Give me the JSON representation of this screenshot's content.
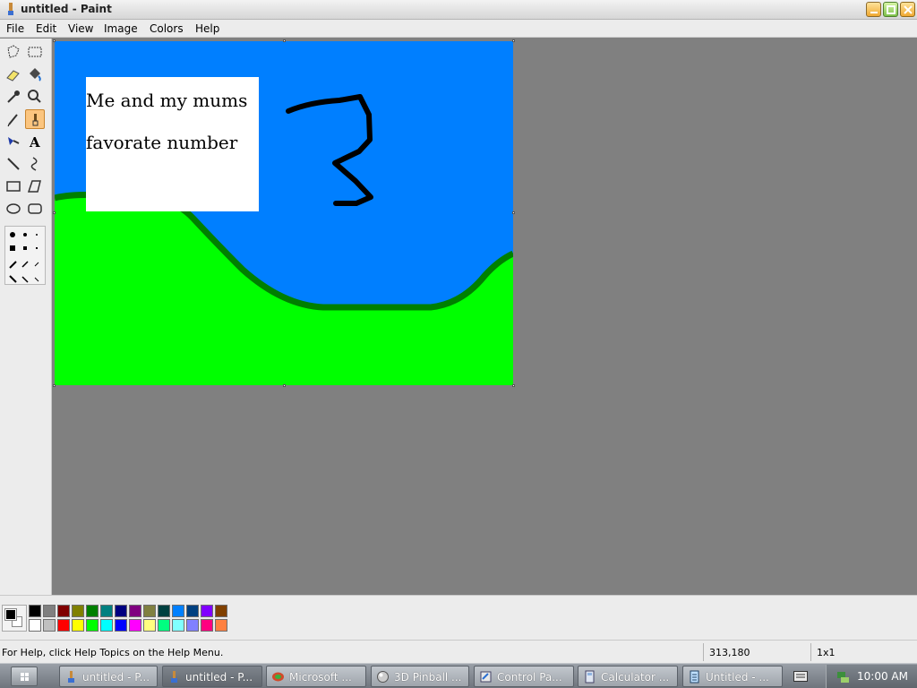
{
  "window": {
    "title": "untitled - Paint",
    "controls": [
      "minimize",
      "maximize",
      "close"
    ]
  },
  "menu": {
    "items": [
      "File",
      "Edit",
      "View",
      "Image",
      "Colors",
      "Help"
    ]
  },
  "toolbox": {
    "tools": [
      {
        "name": "free-form-select",
        "icon": "freeform-select-icon",
        "active": false
      },
      {
        "name": "select",
        "icon": "rect-select-icon",
        "active": false
      },
      {
        "name": "eraser",
        "icon": "eraser-icon",
        "active": false
      },
      {
        "name": "fill",
        "icon": "fill-bucket-icon",
        "active": false
      },
      {
        "name": "pick-color",
        "icon": "eyedropper-icon",
        "active": false
      },
      {
        "name": "magnifier",
        "icon": "magnifier-icon",
        "active": false
      },
      {
        "name": "pencil",
        "icon": "pencil-icon",
        "active": false
      },
      {
        "name": "brush",
        "icon": "brush-icon",
        "active": true
      },
      {
        "name": "airbrush",
        "icon": "airbrush-icon",
        "active": false
      },
      {
        "name": "text",
        "icon": "text-icon",
        "active": false
      },
      {
        "name": "line",
        "icon": "line-icon",
        "active": false
      },
      {
        "name": "curve",
        "icon": "curve-icon",
        "active": false
      },
      {
        "name": "rectangle",
        "icon": "rectangle-icon",
        "active": false
      },
      {
        "name": "polygon",
        "icon": "polygon-icon",
        "active": false
      },
      {
        "name": "ellipse",
        "icon": "ellipse-icon",
        "active": false
      },
      {
        "name": "rounded-rectangle",
        "icon": "rounded-rect-icon",
        "active": false
      }
    ]
  },
  "canvas": {
    "sky_color": "#007fff",
    "hill_color": "#00ff00",
    "hill_outline_color": "#007f00",
    "text_lines": [
      "Me and my mums",
      "favorate number"
    ],
    "drawn_shape": "3"
  },
  "palette": {
    "foreground": "#000000",
    "background": "#ffffff",
    "top_row": [
      "#000000",
      "#808080",
      "#800000",
      "#808000",
      "#008000",
      "#008080",
      "#000080",
      "#800080",
      "#808040",
      "#004040",
      "#0080ff",
      "#004080",
      "#8000ff",
      "#804000"
    ],
    "bottom_row": [
      "#ffffff",
      "#c0c0c0",
      "#ff0000",
      "#ffff00",
      "#00ff00",
      "#00ffff",
      "#0000ff",
      "#ff00ff",
      "#ffff80",
      "#00ff80",
      "#80ffff",
      "#8080ff",
      "#ff0080",
      "#ff8040"
    ]
  },
  "status": {
    "help": "For Help, click Help Topics on the Help Menu.",
    "coords": "313,180",
    "size": "1x1"
  },
  "taskbar": {
    "buttons": [
      {
        "label": "untitled - P...",
        "icon": "paint-icon",
        "active": false
      },
      {
        "label": "untitled - P...",
        "icon": "paint-icon",
        "active": true
      },
      {
        "label": "Microsoft ...",
        "icon": "microsoft-icon",
        "active": false
      },
      {
        "label": "3D Pinball ...",
        "icon": "pinball-icon",
        "active": false
      },
      {
        "label": "Control Pa...",
        "icon": "control-panel-icon",
        "active": false
      },
      {
        "label": "Calculator ...",
        "icon": "calculator-icon",
        "active": false
      },
      {
        "label": "Untitled - ...",
        "icon": "notepad-icon",
        "active": false
      }
    ],
    "clock": "10:00 AM"
  }
}
